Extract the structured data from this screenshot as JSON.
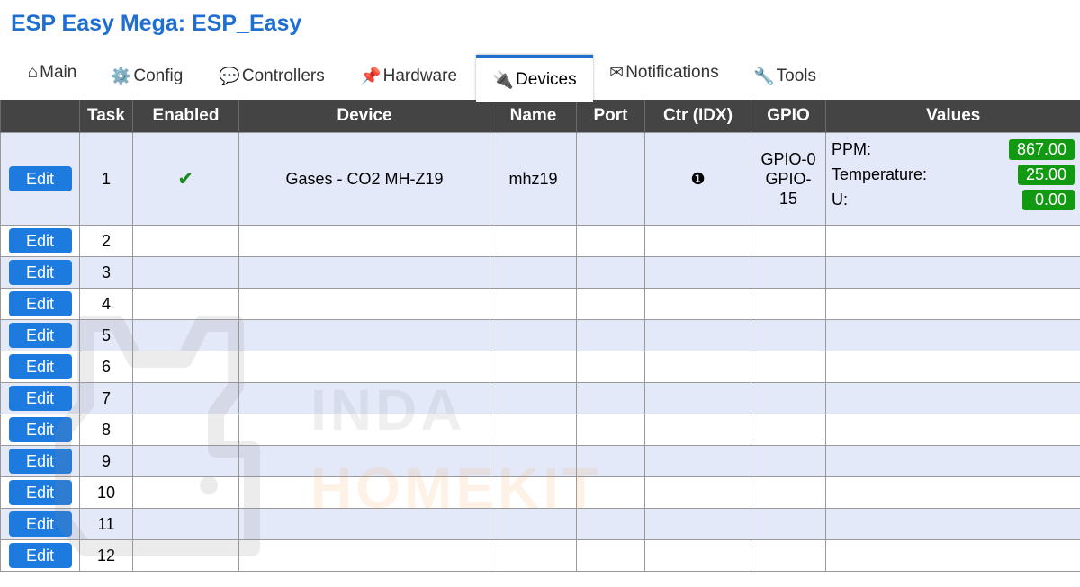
{
  "header": {
    "title": "ESP Easy Mega: ESP_Easy"
  },
  "tabs": [
    {
      "icon": "⌂",
      "label": "Main",
      "active": false
    },
    {
      "icon": "⚙️",
      "label": "Config",
      "active": false
    },
    {
      "icon": "💬",
      "label": "Controllers",
      "active": false
    },
    {
      "icon": "📌",
      "label": "Hardware",
      "active": false
    },
    {
      "icon": "🔌",
      "label": "Devices",
      "active": true
    },
    {
      "icon": "✉",
      "label": "Notifications",
      "active": false
    },
    {
      "icon": "🔧",
      "label": "Tools",
      "active": false
    }
  ],
  "table": {
    "headers": [
      "",
      "Task",
      "Enabled",
      "Device",
      "Name",
      "Port",
      "Ctr (IDX)",
      "GPIO",
      "Values"
    ],
    "edit_label": "Edit",
    "first_row": {
      "task": "1",
      "enabled_icon": "✔",
      "device": "Gases - CO2 MH-Z19",
      "name": "mhz19",
      "port": "",
      "ctr": "❶",
      "gpio": [
        "GPIO-0",
        "GPIO-",
        "15"
      ],
      "values": [
        {
          "name": "PPM:",
          "value": "867.00"
        },
        {
          "name": "Temperature:",
          "value": "25.00"
        },
        {
          "name": "U:",
          "value": "0.00"
        }
      ]
    },
    "empty_tasks": [
      "2",
      "3",
      "4",
      "5",
      "6",
      "7",
      "8",
      "9",
      "10",
      "11",
      "12"
    ]
  },
  "watermark": {
    "line1": "INDA",
    "line2": "HOMEKIT"
  },
  "colors": {
    "accent": "#1f6fd1",
    "header_bg": "#444444",
    "row_shade": "#e4e9fa",
    "value_badge": "#119a11",
    "edit_button": "#1d7be0"
  }
}
